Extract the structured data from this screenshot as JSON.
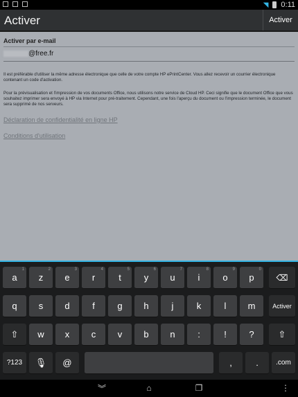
{
  "status": {
    "time": "0:11"
  },
  "actionbar": {
    "title": "Activer",
    "action_label": "Activer"
  },
  "form": {
    "section_title": "Activer par e-mail",
    "email_value": "@free.fr",
    "paragraph1": "Il est préférable d'utiliser la même adresse électronique que celle de votre compte HP ePrintCenter. Vous allez recevoir un courrier électronique contenant un code d'activation.",
    "paragraph2": "Pour la prévisualisation et l'impression de vos documents Office, nous utilisons notre service de Cloud HP. Ceci signifie que le document Office que vous souhaitez imprimer sera envoyé à HP via Internet pour pré-traitement. Cependant, une fois l'aperçu du document ou l'impression terminée, le document sera supprimé de nos serveurs.",
    "link_privacy": "Déclaration de confidentialité en ligne HP",
    "link_terms": "Conditions d'utilisation"
  },
  "keyboard": {
    "row1": [
      {
        "label": "a",
        "hint": "1"
      },
      {
        "label": "z",
        "hint": "2"
      },
      {
        "label": "e",
        "hint": "3"
      },
      {
        "label": "r",
        "hint": "4"
      },
      {
        "label": "t",
        "hint": "5"
      },
      {
        "label": "y",
        "hint": "6"
      },
      {
        "label": "u",
        "hint": "7"
      },
      {
        "label": "i",
        "hint": "8"
      },
      {
        "label": "o",
        "hint": "9"
      },
      {
        "label": "p",
        "hint": "0"
      }
    ],
    "row2": [
      "q",
      "s",
      "d",
      "f",
      "g",
      "h",
      "j",
      "k",
      "l",
      "m"
    ],
    "row3": [
      "w",
      "x",
      "c",
      "v",
      "b",
      "n",
      ":",
      "!",
      "?"
    ],
    "enter_label": "Activer",
    "symbols_label": "?123",
    "at_label": "@",
    "comma_label": ",",
    "period_label": ".",
    "com_label": ".com"
  }
}
